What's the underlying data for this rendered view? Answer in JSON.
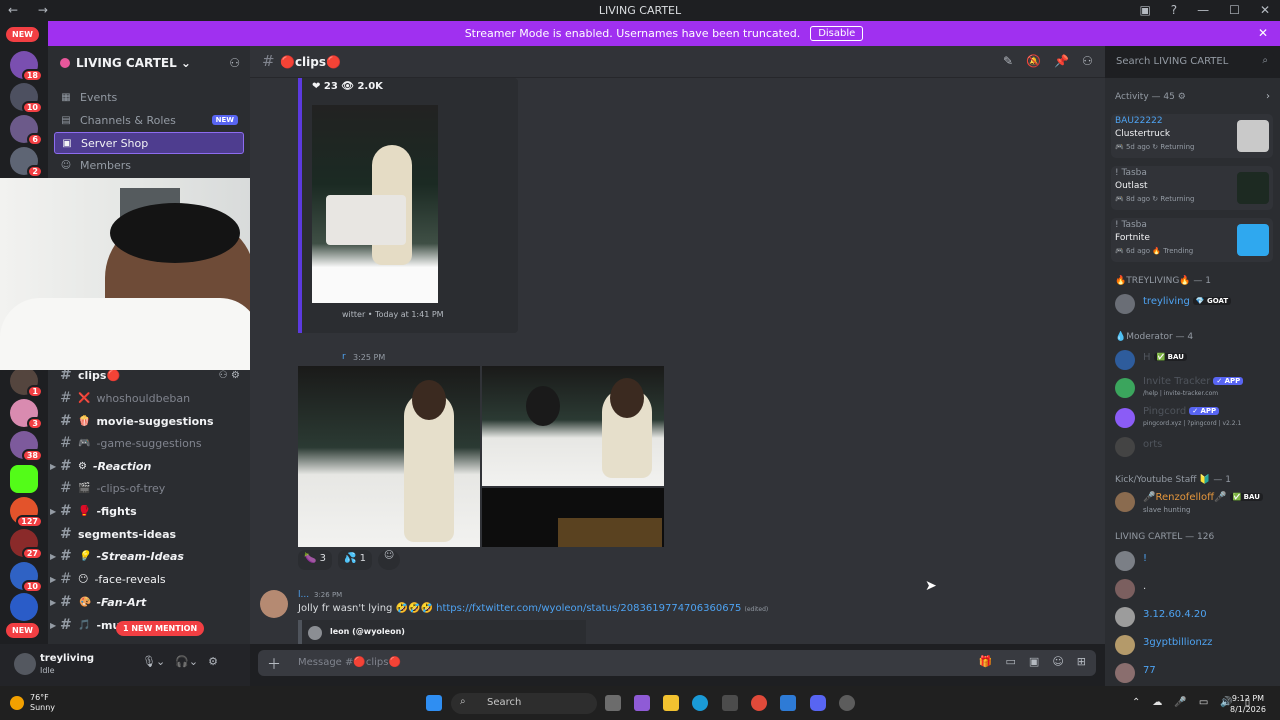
{
  "window": {
    "title": "LIVING CARTEL",
    "nav": "← →",
    "controls": [
      "▣",
      "?",
      "—",
      "☐",
      "✕"
    ]
  },
  "banner": {
    "text": "Streamer Mode is enabled. Usernames have been truncated.",
    "button": "Disable",
    "close": "✕"
  },
  "rail": {
    "new_top": "NEW",
    "new_bottom": "NEW",
    "badges": [
      "18",
      "10",
      "6",
      "2",
      "1",
      "3",
      "38",
      "127",
      "27",
      "10"
    ]
  },
  "server": {
    "name": "LIVING CARTEL ⌄"
  },
  "nav_items": [
    {
      "icon": "▦",
      "label": "Events"
    },
    {
      "icon": "▤",
      "label": "Channels & Roles",
      "tag": "NEW"
    },
    {
      "icon": "▣",
      "label": "Server Shop"
    },
    {
      "icon": "☺",
      "label": "Members"
    }
  ],
  "channels": [
    {
      "emoji": "🔴",
      "label": "clips🔴"
    },
    {
      "emoji": "❌",
      "label": "whoshouldbeban"
    },
    {
      "emoji": "🍿",
      "label": "movie-suggestions"
    },
    {
      "emoji": "🎮",
      "label": "-game-suggestions"
    },
    {
      "emoji": "⚙",
      "label": "-Reaction"
    },
    {
      "emoji": "🎬",
      "label": "-clips-of-trey"
    },
    {
      "emoji": "🥊",
      "label": "-fights"
    },
    {
      "emoji": "",
      "label": "segments-ideas"
    },
    {
      "emoji": "💡",
      "label": "-Stream-Ideas"
    },
    {
      "emoji": "😶",
      "label": "-face-reveals"
    },
    {
      "emoji": "🎨",
      "label": "-Fan-Art"
    },
    {
      "emoji": "🎵",
      "label": "-musi"
    }
  ],
  "mention_pill": "1 NEW MENTION",
  "user_panel": {
    "name": "treyliving",
    "status": "Idle"
  },
  "channel_header": {
    "name": "🔴clips🔴"
  },
  "search": {
    "placeholder": "Search LIVING CARTEL"
  },
  "embed": {
    "likes": "❤ 23",
    "views": "👁 2.0K",
    "footer": "witter • Today at 1:41 PM"
  },
  "message1": {
    "name": "r",
    "time": "3:25 PM"
  },
  "reactions": [
    {
      "emoji": "🍆",
      "count": "3"
    },
    {
      "emoji": "💦",
      "count": "1"
    }
  ],
  "message2": {
    "name": "l...",
    "time": "3:26 PM",
    "text": "Jolly fr wasn't lying 🤣🤣🤣 ",
    "link": "https://fxtwitter.com/wyoleon/status/2083619774706360675",
    "edited": "(edited)",
    "embed_author": "leon (@wyoleon)"
  },
  "composer": {
    "placeholder": "Message #🔴clips🔴"
  },
  "activity": {
    "header": "Activity — 45 ⚙",
    "cards": [
      {
        "who": "BAU22222",
        "game": "Clustertruck",
        "meta": "🎮 5d ago  ↻ Returning",
        "thumb_color": "#c9c9c9"
      },
      {
        "who": "! Tasba",
        "game": "Outlast",
        "meta": "🎮 8d ago  ↻ Returning",
        "thumb_color": "#1d2a22"
      },
      {
        "who": "! Tasba",
        "game": "Fortnite",
        "meta": "🎮 6d ago  🔥 Trending",
        "thumb_color": "#2fa8ef"
      }
    ]
  },
  "member_groups": [
    {
      "label": "🔥TREYLIVING🔥 — 1"
    },
    {
      "label": "💧Moderator — 4"
    },
    {
      "label": "Kick/Youtube Staff 🔰 — 1"
    },
    {
      "label": "LIVING CARTEL — 126"
    }
  ],
  "members": {
    "trey": {
      "name": "treyliving",
      "tag": "💎 GOAT"
    },
    "mod1": {
      "name": "H",
      "tag": "✅ BAU"
    },
    "mod2": {
      "name": "Invite Tracker",
      "tag": "✓ APP",
      "sub": "/help | invite-tracker.com"
    },
    "mod3": {
      "name": "Pingcord",
      "tag": "✓ APP",
      "sub": "pingcord.xyz | ?pingcord | v2.2.1"
    },
    "mod4": {
      "name": "orts"
    },
    "staff": {
      "name": "🎤Renzofelloff🎤",
      "tag": "✅ BAU",
      "sub": "slave hunting"
    },
    "lc1": {
      "name": "!"
    },
    "lc2": {
      "name": "."
    },
    "lc3": {
      "name": "3.12.60.4.20"
    },
    "lc4": {
      "name": "3gyptbillionzz"
    },
    "lc5": {
      "name": "77"
    }
  },
  "taskbar": {
    "temp": "76°F",
    "cond": "Sunny",
    "search": "Search",
    "time": "9:12 PM",
    "date": "8/1/2026",
    "tray": [
      "⌃",
      "☁",
      "🎤",
      "▭",
      "🔊",
      "▯"
    ]
  }
}
